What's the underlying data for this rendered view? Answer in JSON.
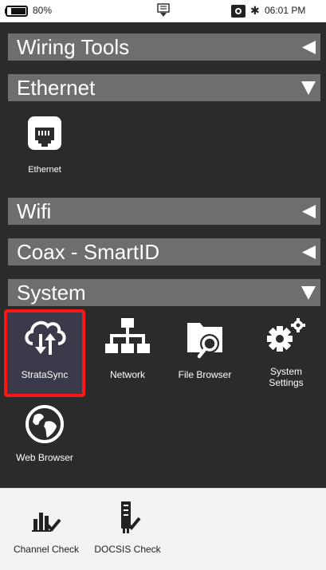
{
  "status_bar": {
    "battery": "80%",
    "time": "06:01 PM",
    "bluetooth_symbol": "✱",
    "icons": [
      "battery-icon",
      "usb-icon",
      "screenshot-icon",
      "bluetooth-icon"
    ]
  },
  "sections": {
    "wiring_tools": {
      "label": "Wiring Tools",
      "state": "collapsed"
    },
    "ethernet": {
      "label": "Ethernet",
      "state": "expanded"
    },
    "wifi": {
      "label": "Wifi",
      "state": "collapsed"
    },
    "coax": {
      "label": "Coax - SmartID",
      "state": "collapsed"
    },
    "system": {
      "label": "System",
      "state": "expanded"
    }
  },
  "ethernet_apps": [
    {
      "label": "Ethernet",
      "icon": "ethernet-port-icon"
    }
  ],
  "system_apps": [
    {
      "label": "StrataSync",
      "icon": "cloud-sync-icon",
      "highlighted": true
    },
    {
      "label": "Network",
      "icon": "network-tree-icon"
    },
    {
      "label": "File Browser",
      "icon": "folder-search-icon"
    },
    {
      "label": "System Settings",
      "icon": "gears-icon"
    },
    {
      "label": "Web Browser",
      "icon": "globe-icon"
    }
  ],
  "dock": [
    {
      "label": "Channel Check",
      "icon": "bar-chart-check-icon"
    },
    {
      "label": "DOCSIS Check",
      "icon": "modem-check-icon"
    }
  ],
  "colors": {
    "background": "#2b2b2b",
    "section_header": "#6e6e6e",
    "highlight_border": "#ff1616",
    "dock_background": "#f3f3f3"
  }
}
